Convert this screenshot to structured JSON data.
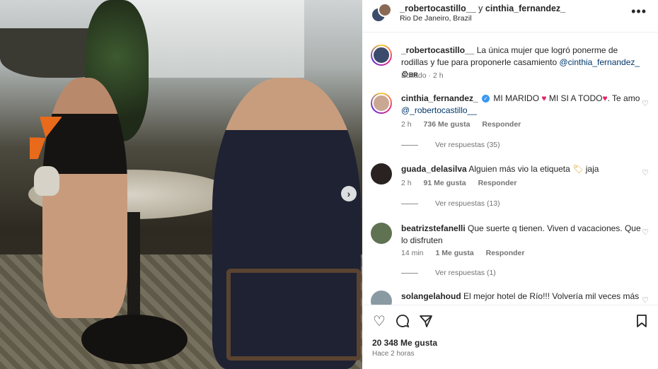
{
  "header": {
    "user1": "_robertocastillo__",
    "joiner": "y",
    "user2": "cinthia_fernandez_",
    "location": "Rio De Janeiro, Brazil"
  },
  "caption": {
    "user": "_robertocastillo__",
    "text": "La única mujer que logró ponerme de rodillas y fue para proponerle casamiento",
    "mention": "@cinthia_fernandez_",
    "suffix": "BR",
    "meta": "Editado · 2 h"
  },
  "comments": [
    {
      "user": "cinthia_fernandez_",
      "text_a": "MI MARIDO",
      "text_b": "MI SI A TODO",
      "text_c": ". Te amo",
      "mention": "@_robertocastillo__",
      "time": "2 h",
      "likes": "736 Me gusta",
      "reply": "Responder",
      "view_replies": "Ver respuestas (35)"
    },
    {
      "user": "guada_delasilva",
      "text": "Alguien más vio la etiqueta",
      "text_end": "jaja",
      "time": "2 h",
      "likes": "91 Me gusta",
      "reply": "Responder",
      "view_replies": "Ver respuestas (13)"
    },
    {
      "user": "beatrizstefanelli",
      "text": "Que suerte q tienen. Viven d vacaciones. Que lo disfruten",
      "time": "14 min",
      "likes": "1 Me gusta",
      "reply": "Responder",
      "view_replies": "Ver respuestas (1)"
    },
    {
      "user": "solangelahoud",
      "text": "El mejor hotel de Río!!! Volvería mil veces más"
    }
  ],
  "footer": {
    "likes": "20 348 Me gusta",
    "time": "Hace 2 horas"
  },
  "colors": {
    "link": "#00376b",
    "verified": "#3897f0",
    "heart": "#e0245e"
  }
}
